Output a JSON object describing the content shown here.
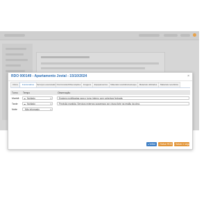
{
  "dialog": {
    "title": "RDO 000149 - Apartamento Jovial - 15/10/2024",
    "close_icon": "×"
  },
  "tabs": [
    {
      "label": "Clima"
    },
    {
      "label": "Funcionários"
    },
    {
      "label": "Serviços executados"
    },
    {
      "label": "Ocorrências/Observações"
    },
    {
      "label": "Imagens"
    },
    {
      "label": "Equipamentos"
    },
    {
      "label": "Materiais recebidos/estoque"
    },
    {
      "label": "Materiais utilizados"
    },
    {
      "label": "Materiais recebidos"
    }
  ],
  "table": {
    "headers": {
      "period": "Turno",
      "weather": "Tempo",
      "notes": "Observação"
    },
    "rows": [
      {
        "period": "Manhã",
        "weather": "Nublado",
        "notes": "Equipes mobilizadas para o turno interno com cobertura fechada."
      },
      {
        "period": "Tarde",
        "weather": "Nublado",
        "notes": "Previsão mantida. Serviços externos suspensos por chuva forte na região da obra."
      },
      {
        "period": "Noite",
        "weather": "Não informado",
        "notes": ""
      }
    ]
  },
  "buttons": {
    "cancel": "Voltar",
    "save": "Salvar RDO",
    "save_next": "Salvar e seguir"
  },
  "colors": {
    "accent": "#2a6db5",
    "primary_button": "#3f7fc4",
    "warning_button": "#e29436",
    "notification_dot": "#e8a24a"
  }
}
